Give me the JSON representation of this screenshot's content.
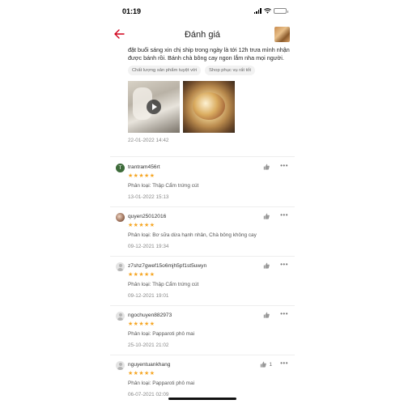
{
  "status_bar": {
    "time": "01:19"
  },
  "header": {
    "title": "Đánh giá"
  },
  "first_review": {
    "text": "đặt buổi sáng xin chị ship trong ngày là tới 12h trưa mình nhận được bánh rồi. Bánh chà bông cay ngon lắm nha mọi người.",
    "tags": [
      "Chất lượng sản phẩm tuyệt vời",
      "Shop phục vụ rất tốt"
    ],
    "date": "22-01-2022 14:42"
  },
  "reviews": [
    {
      "username": "trantram456rt",
      "avatar_letter": "T",
      "stars": "★★★★★",
      "variant": "Phân loại: Thập Cẩm trứng cút",
      "date": "13-01-2022 15:13",
      "likes": ""
    },
    {
      "username": "quyen25012016",
      "avatar_letter": "",
      "stars": "★★★★★",
      "variant": "Phân loại: Bơ sữa dừa hạnh nhân, Chà bông không cay",
      "date": "09-12-2021 19:34",
      "likes": ""
    },
    {
      "username": "z7shz7gwef15o6mjh5pf1st5uwyn",
      "avatar_letter": "",
      "stars": "★★★★★",
      "variant": "Phân loại: Thập Cẩm trứng cút",
      "date": "09-12-2021 19:01",
      "likes": ""
    },
    {
      "username": "ngochuyen882973",
      "avatar_letter": "",
      "stars": "★★★★★",
      "variant": "Phân loại: Papparoti phô mai",
      "date": "25-10-2021 21:02",
      "likes": ""
    },
    {
      "username": "nguyentuankhang",
      "avatar_letter": "",
      "stars": "★★★★★",
      "variant": "Phân loại: Papparoti phô mai",
      "date": "06-07-2021 02:09",
      "likes": "1"
    }
  ],
  "colors": {
    "accent": "#d0011b",
    "star": "#f6a623"
  },
  "icons": {
    "back": "back-arrow-icon",
    "like": "thumbs-up-icon",
    "more": "more-dots-icon",
    "play": "play-icon"
  }
}
